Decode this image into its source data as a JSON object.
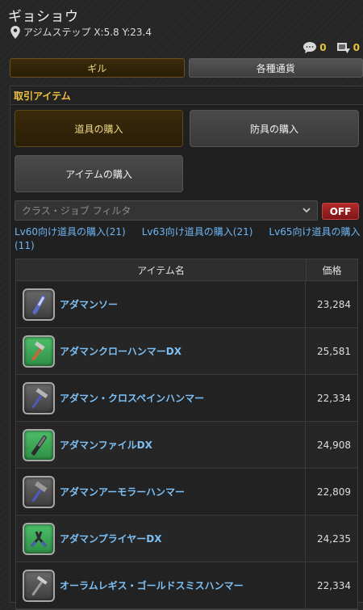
{
  "npc": {
    "name": "ギョショウ"
  },
  "location": {
    "text": "アジムステップ X:5.8 Y:23.4",
    "icon": "location-pin-icon"
  },
  "counters": [
    {
      "icon": "chat-bubble-icon",
      "value": "0"
    },
    {
      "icon": "retainer-icon",
      "value": "0"
    }
  ],
  "tabs": [
    {
      "label": "ギル",
      "active": true
    },
    {
      "label": "各種通貨",
      "active": false
    }
  ],
  "panel": {
    "title": "取引アイテム"
  },
  "categories": [
    {
      "label": "道具の購入",
      "selected": true
    },
    {
      "label": "防具の購入",
      "selected": false
    },
    {
      "label": "アイテムの購入",
      "selected": false
    }
  ],
  "filter": {
    "placeholder": "クラス・ジョブ フィルタ",
    "toggle": "OFF"
  },
  "links": [
    "Lv60向け道具の購入(21)",
    "Lv63向け道具の購入(21)",
    "Lv65向け道具の購入(11)"
  ],
  "table": {
    "headers": {
      "name": "アイテム名",
      "price": "価格"
    },
    "rows": [
      {
        "icon": "saw-icon",
        "name": "アダマンソー",
        "price": "23,284",
        "rarity": "#8a8a8a"
      },
      {
        "icon": "claw-hammer-icon",
        "name": "アダマンクローハンマーDX",
        "price": "25,581",
        "rarity": "#3fbf5a"
      },
      {
        "icon": "cross-pein-hammer-icon",
        "name": "アダマン・クロスペインハンマー",
        "price": "22,334",
        "rarity": "#8a8a8a"
      },
      {
        "icon": "file-icon",
        "name": "アダマンファイルDX",
        "price": "24,908",
        "rarity": "#3fbf5a"
      },
      {
        "icon": "armorer-hammer-icon",
        "name": "アダマンアーモラーハンマー",
        "price": "22,809",
        "rarity": "#8a8a8a"
      },
      {
        "icon": "pliers-icon",
        "name": "アダマンプライヤーDX",
        "price": "24,235",
        "rarity": "#3fbf5a"
      },
      {
        "icon": "goldsmith-hammer-icon",
        "name": "オーラムレギス・ゴールドスミスハンマー",
        "price": "22,334",
        "rarity": "#8a8a8a"
      }
    ]
  }
}
